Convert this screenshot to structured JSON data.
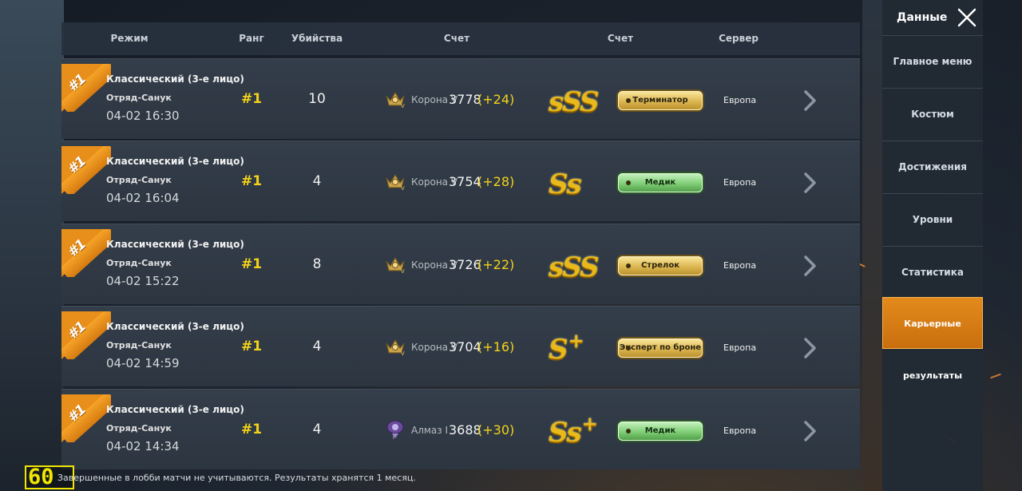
{
  "header": {
    "mode": "Режим",
    "rank": "Ранг",
    "kills": "Убийства",
    "score": "Счет",
    "grade": "Счет",
    "server": "Сервер"
  },
  "matches": [
    {
      "ribbon": "#1",
      "mode": "Классический (3-е лицо)",
      "team": "Отряд-Санук",
      "time": "04-02 16:30",
      "rank": "#1",
      "kills": "10",
      "tier": "Корона V",
      "tier_icon": "crown-tier-icon",
      "points": "3778",
      "delta": "(+24)",
      "grade": "sSS",
      "grade_plus": "",
      "title": "Терминатор",
      "title_color": "gold",
      "server": "Европа"
    },
    {
      "ribbon": "#1",
      "mode": "Классический (3-е лицо)",
      "team": "Отряд-Санук",
      "time": "04-02 16:04",
      "rank": "#1",
      "kills": "4",
      "tier": "Корона V",
      "tier_icon": "crown-tier-icon",
      "points": "3754",
      "delta": "(+28)",
      "grade": "Ss",
      "grade_plus": "",
      "title": "Медик",
      "title_color": "green",
      "server": "Европа"
    },
    {
      "ribbon": "#1",
      "mode": "Классический (3-е лицо)",
      "team": "Отряд-Санук",
      "time": "04-02 15:22",
      "rank": "#1",
      "kills": "8",
      "tier": "Корона V",
      "tier_icon": "crown-tier-icon",
      "points": "3726",
      "delta": "(+22)",
      "grade": "sSS",
      "grade_plus": "",
      "title": "Стрелок",
      "title_color": "gold",
      "server": "Европа"
    },
    {
      "ribbon": "#1",
      "mode": "Классический (3-е лицо)",
      "team": "Отряд-Санук",
      "time": "04-02 14:59",
      "rank": "#1",
      "kills": "4",
      "tier": "Корона V",
      "tier_icon": "crown-tier-icon",
      "points": "3704",
      "delta": "(+16)",
      "grade": "S",
      "grade_plus": "+",
      "title": "Эксперт по броне",
      "title_color": "gold",
      "server": "Европа"
    },
    {
      "ribbon": "#1",
      "mode": "Классический (3-е лицо)",
      "team": "Отряд-Санук",
      "time": "04-02 14:34",
      "rank": "#1",
      "kills": "4",
      "tier": "Алмаз I",
      "tier_icon": "diamond-tier-icon",
      "points": "3688",
      "delta": "(+30)",
      "grade": "Ss",
      "grade_plus": "+",
      "title": "Медик",
      "title_color": "green",
      "server": "Европа"
    }
  ],
  "footer": {
    "note": "Завершенные в лобби матчи не учитываются. Результаты хранятся 1 месяц.",
    "fps": "60"
  },
  "sidebar": {
    "title": "Данные",
    "items": [
      {
        "label": "Главное меню",
        "active": false
      },
      {
        "label": "Костюм",
        "active": false
      },
      {
        "label": "Достижения",
        "active": false
      },
      {
        "label": "Уровни",
        "active": false
      },
      {
        "label": "Статистика",
        "active": false
      },
      {
        "label": "Карьерные результаты",
        "active": true
      }
    ]
  },
  "colors": {
    "accent": "#e38a1c",
    "rank_yellow": "#f3d21a",
    "panel": "#2f3944"
  }
}
